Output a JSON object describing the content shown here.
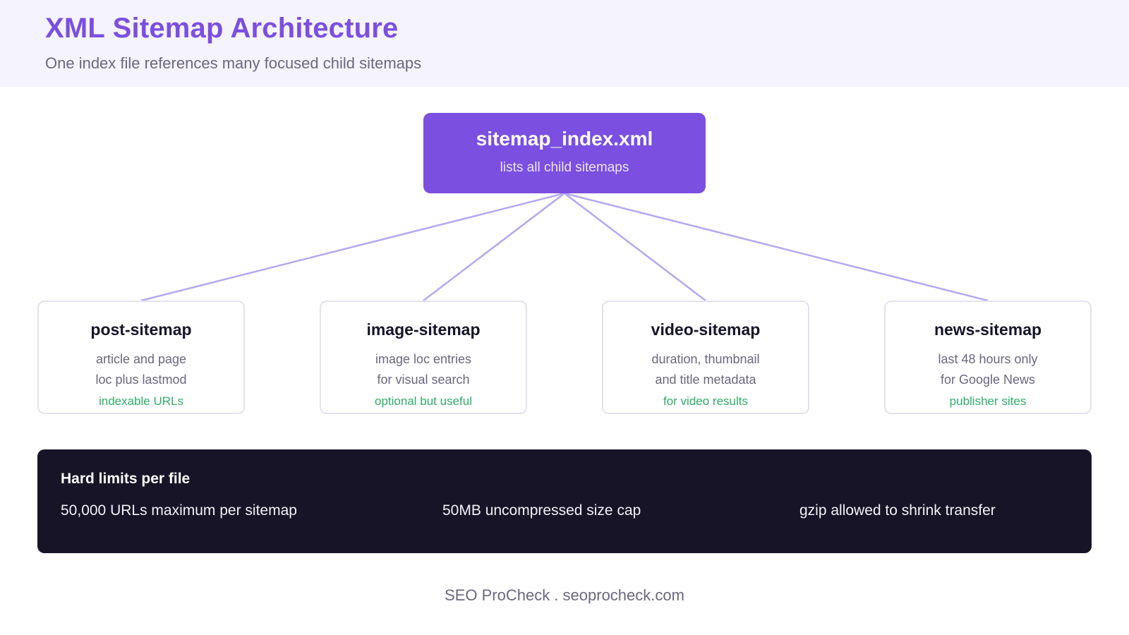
{
  "header": {
    "title": "XML Sitemap Architecture",
    "subtitle": "One index file references many focused child sitemaps"
  },
  "index": {
    "title": "sitemap_index.xml",
    "subtitle": "lists all child sitemaps"
  },
  "children": [
    {
      "title": "post-sitemap",
      "line1": "article and page",
      "line2": "loc plus lastmod",
      "note": "indexable URLs"
    },
    {
      "title": "image-sitemap",
      "line1": "image loc entries",
      "line2": "for visual search",
      "note": "optional but useful"
    },
    {
      "title": "video-sitemap",
      "line1": "duration, thumbnail",
      "line2": "and title metadata",
      "note": "for video results"
    },
    {
      "title": "news-sitemap",
      "line1": "last 48 hours only",
      "line2": "for Google News",
      "note": "publisher sites"
    }
  ],
  "limits": {
    "title": "Hard limits per file",
    "items": [
      "50,000 URLs maximum per sitemap",
      "50MB uncompressed size cap",
      "gzip allowed to shrink transfer"
    ]
  },
  "footer": {
    "text": "SEO ProCheck . seoprocheck.com"
  },
  "colors": {
    "accent": "#7b4fe0",
    "connector": "#b6a8ef",
    "note_green": "#2eae67",
    "dark_panel": "#161426",
    "header_bg": "#f5f3fd"
  }
}
